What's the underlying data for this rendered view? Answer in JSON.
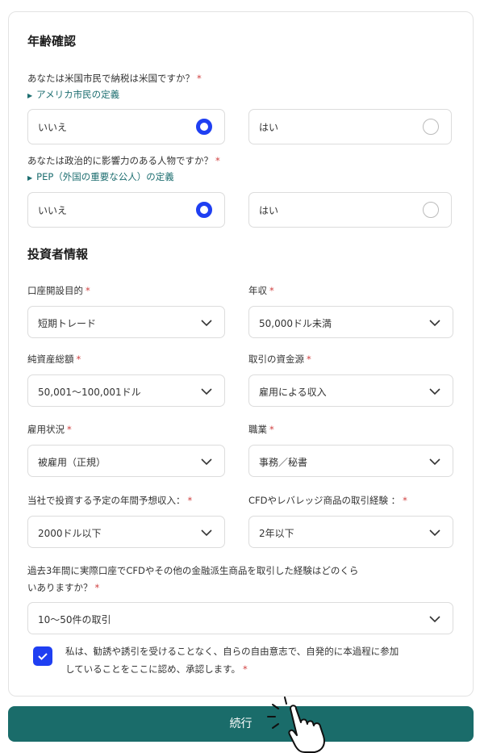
{
  "sections": {
    "age_title": "年齢確認",
    "investor_title": "投資者情報"
  },
  "q_us": {
    "text": "あなたは米国市民で納税は米国ですか？",
    "link": "アメリカ市民の定義",
    "no": "いいえ",
    "yes": "はい",
    "selected": "no"
  },
  "q_pep": {
    "text": "あなたは政治的に影響力のある人物ですか？",
    "link": "PEP（外国の重要な公人）の定義",
    "no": "いいえ",
    "yes": "はい",
    "selected": "no"
  },
  "required_mark": "*",
  "fields": {
    "purpose": {
      "label": "口座開設目的",
      "value": "短期トレード"
    },
    "income": {
      "label": "年収",
      "value": "50,000ドル未満"
    },
    "networth": {
      "label": "純資産総額",
      "value": "50,001〜100,001ドル"
    },
    "source": {
      "label": "取引の資金源",
      "value": "雇用による収入"
    },
    "employment": {
      "label": "雇用状況",
      "value": "被雇用（正規）"
    },
    "occupation": {
      "label": "職業",
      "value": "事務／秘書"
    },
    "expected": {
      "label": "当社で投資する予定の年間予想収入：",
      "value": "2000ドル以下"
    },
    "experience": {
      "label": "CFDやレバレッジ商品の取引経験 ：",
      "value": "2年以下"
    },
    "past": {
      "label_line1": "過去3年間に実際口座でCFDやその他の金融派生商品を取引した経験はどのくら",
      "label_line2": "いありますか？",
      "value": "10〜50件の取引"
    }
  },
  "consent": {
    "checked": true,
    "text_line1": "私は、勧誘や誘引を受けることなく、自らの自由意志で、自発的に本過程に参加",
    "text_line2": "していることをここに認め、承認します。"
  },
  "continue_button": "続行",
  "colors": {
    "accent": "#1f3ff2",
    "button": "#1a6c6a",
    "link": "#1d6e70",
    "required": "#d04040"
  }
}
